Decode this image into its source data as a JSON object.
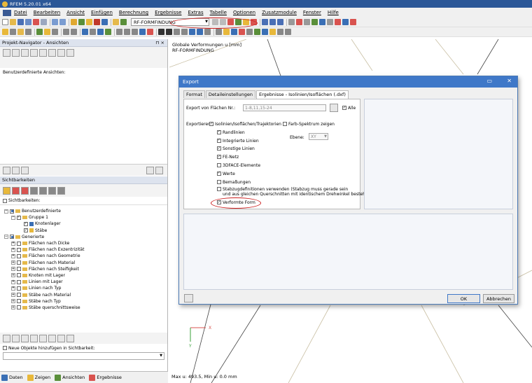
{
  "app": {
    "title": "RFEM 5.20.01 x64"
  },
  "menu": [
    "Datei",
    "Bearbeiten",
    "Ansicht",
    "Einfügen",
    "Berechnung",
    "Ergebnisse",
    "Extras",
    "Tabelle",
    "Optionen",
    "Zusatzmodule",
    "Fenster",
    "Hilfe"
  ],
  "toolbar": {
    "module_combo": "RF-FORMFINDUNG"
  },
  "navigator": {
    "title": "Projekt-Navigator - Ansichten",
    "user_views_label": "Benutzerdefinierte Ansichten:",
    "visibility_title": "Sichtbarkeiten",
    "visibility_check": "Sichtbarkeiten:",
    "tree": [
      {
        "label": "Benutzerdefinierte",
        "level": 0,
        "checked": "partial"
      },
      {
        "label": "Gruppe 1",
        "level": 1,
        "checked": "yes"
      },
      {
        "label": "Knotenlager",
        "level": 2,
        "checked": "yes"
      },
      {
        "label": "Stäbe",
        "level": 2,
        "checked": "yes"
      },
      {
        "label": "Generierte",
        "level": 0,
        "checked": "partial"
      },
      {
        "label": "Flächen nach Dicke",
        "level": 1,
        "checked": "no"
      },
      {
        "label": "Flächen nach Exzentrizität",
        "level": 1,
        "checked": "no"
      },
      {
        "label": "Flächen nach Geometrie",
        "level": 1,
        "checked": "no"
      },
      {
        "label": "Flächen nach Material",
        "level": 1,
        "checked": "no"
      },
      {
        "label": "Flächen nach Steifigkeit",
        "level": 1,
        "checked": "no"
      },
      {
        "label": "Knoten mit Lager",
        "level": 1,
        "checked": "no"
      },
      {
        "label": "Linien mit Lager",
        "level": 1,
        "checked": "no"
      },
      {
        "label": "Linien nach Typ",
        "level": 1,
        "checked": "no"
      },
      {
        "label": "Stäbe nach Material",
        "level": 1,
        "checked": "no"
      },
      {
        "label": "Stäbe nach Typ",
        "level": 1,
        "checked": "no"
      },
      {
        "label": "Stäbe querschnittsweise",
        "level": 1,
        "checked": "no"
      }
    ],
    "new_objects_label": "Neue Objekte hinzufügen in Sichtbarkeit:",
    "tabs": [
      "Daten",
      "Zeigen",
      "Ansichten",
      "Ergebnisse"
    ]
  },
  "viewport": {
    "title_line1": "Globale Verformungen u [mm]",
    "title_line2": "RF-FORMFINDUNG",
    "bottom_text": "Max u: 493.5, Min u: 0.0 mm",
    "axis_x": "X",
    "axis_y": "Y"
  },
  "dialog": {
    "title": "Export",
    "tabs": [
      "Format",
      "Detaileinstellungen",
      "Ergebnisse - Isolinien/Isoflächen (.dxf)"
    ],
    "active_tab": 2,
    "export_from_label": "Export von Flächen Nr.:",
    "export_from_value": "1-8,11,15-24",
    "all_label": "Alle",
    "export_label": "Exportieren:",
    "options": [
      {
        "label": "Isolinien/Isoflächen/Trajektorien",
        "checked": true
      },
      {
        "label": "Randlinien",
        "checked": true
      },
      {
        "label": "Integrierte Linien",
        "checked": true
      },
      {
        "label": "Sonstige Linien",
        "checked": true
      },
      {
        "label": "FE-Netz",
        "checked": true
      },
      {
        "label": "3DFACE-Elemente",
        "checked": false
      },
      {
        "label": "Werte",
        "checked": true
      },
      {
        "label": "Bemaßungen",
        "checked": false
      }
    ],
    "member_def_line1": "Stabzugdefinitionen verwenden (Stabzug muss gerade sein",
    "member_def_line2": "und aus gleichen Querschnitten mit identischem Drehwinkel bestehen)",
    "deformed_label": "Verformte Form",
    "color_spectrum_label": "Farb-Spektrum zeigen",
    "plane_label": "Ebene:",
    "plane_value": "XY",
    "ok_label": "OK",
    "cancel_label": "Abbrechen"
  }
}
